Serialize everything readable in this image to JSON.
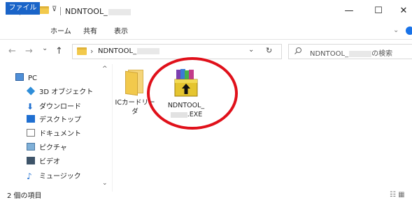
{
  "window": {
    "title": "NDNTOOL_",
    "minimize_label": "—",
    "maximize_label": "☐",
    "close_label": "✕"
  },
  "ribbon": {
    "tabs": [
      {
        "label": "ファイル"
      },
      {
        "label": "ホーム"
      },
      {
        "label": "共有"
      },
      {
        "label": "表示"
      }
    ],
    "expand_label": "⌄"
  },
  "address": {
    "back": "←",
    "forward": "→",
    "recent": "⌄",
    "up": "↑",
    "separator": "›",
    "path": "NDNTOOL_",
    "dropdown": "⌄",
    "refresh": "↻",
    "search_placeholder": "NDNTOOL_",
    "search_suffix": "の検索"
  },
  "sidebar": {
    "items": [
      {
        "label": "PC",
        "icon": "pc-icon"
      },
      {
        "label": "3D オブジェクト",
        "icon": "3d-objects-icon"
      },
      {
        "label": "ダウンロード",
        "icon": "download-icon"
      },
      {
        "label": "デスクトップ",
        "icon": "desktop-icon"
      },
      {
        "label": "ドキュメント",
        "icon": "documents-icon"
      },
      {
        "label": "ピクチャ",
        "icon": "pictures-icon"
      },
      {
        "label": "ビデオ",
        "icon": "videos-icon"
      },
      {
        "label": "ミュージック",
        "icon": "music-icon"
      }
    ],
    "scroll_up": "^",
    "scroll_down": "⌄"
  },
  "files": [
    {
      "label": "ICカードリーダ",
      "icon": "folder-icon"
    },
    {
      "label_line1": "NDNTOOL_",
      "label_line2": ".EXE",
      "icon": "winrar-archive-icon"
    }
  ],
  "status": {
    "item_count": "2 個の項目",
    "view_icons": "☷ ▦"
  },
  "colors": {
    "accent": "#1a64c8",
    "highlight": "#e0101a",
    "folder": "#f2c94c"
  }
}
